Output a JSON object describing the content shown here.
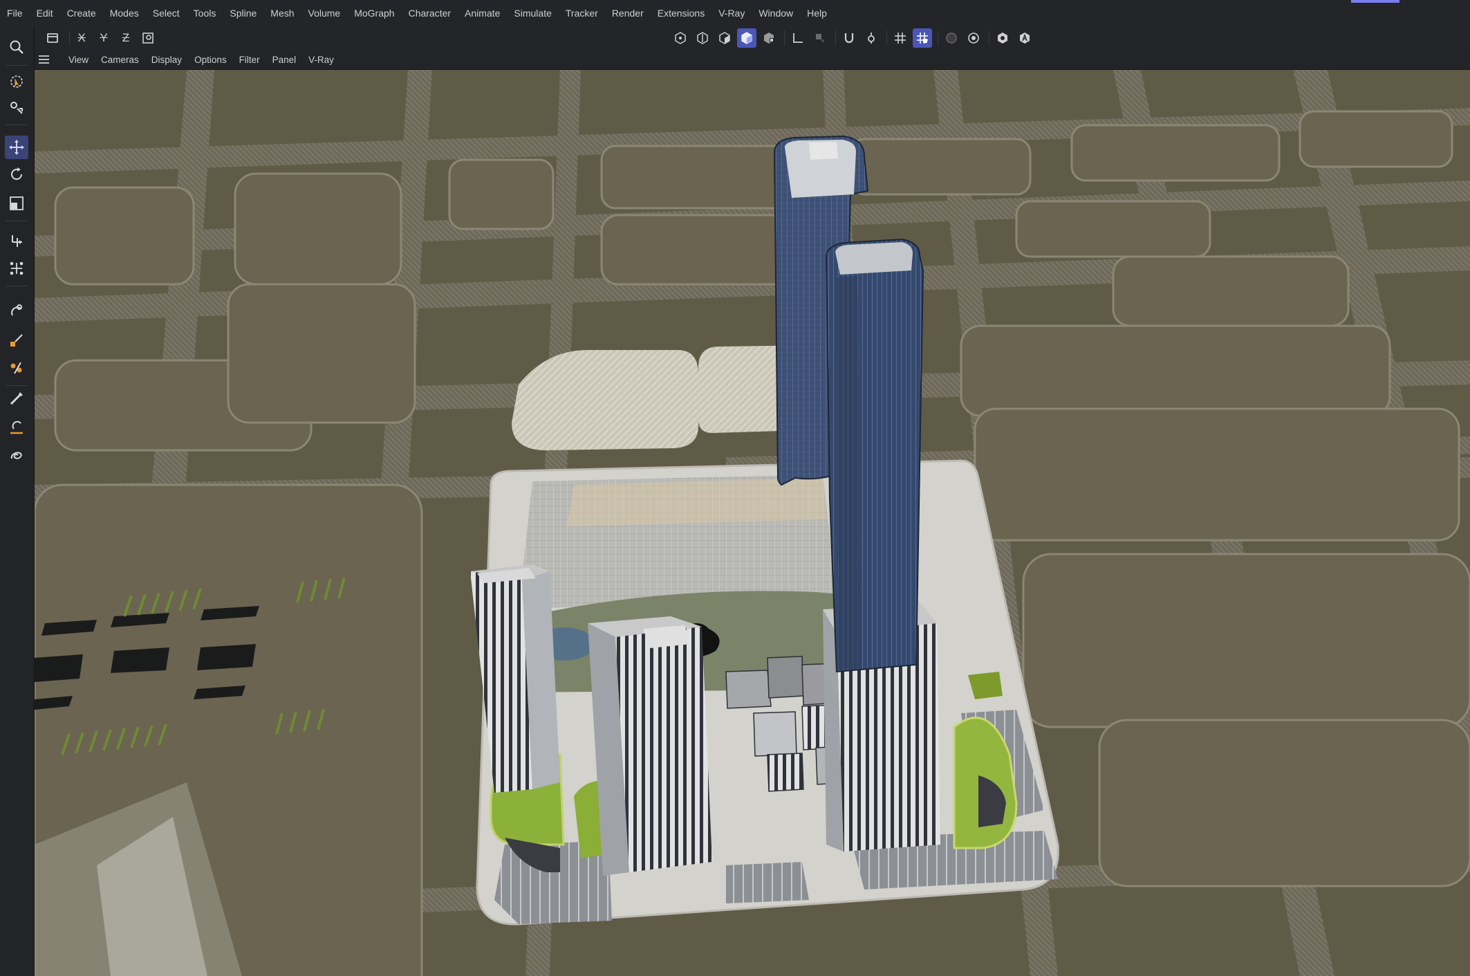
{
  "menu": [
    "File",
    "Edit",
    "Create",
    "Modes",
    "Select",
    "Tools",
    "Spline",
    "Mesh",
    "Volume",
    "MoGraph",
    "Character",
    "Animate",
    "Simulate",
    "Tracker",
    "Render",
    "Extensions",
    "V-Ray",
    "Window",
    "Help"
  ],
  "toolbar": {
    "axis_x": "X",
    "axis_y": "Y",
    "axis_z": "Z"
  },
  "viewport_menu": [
    "View",
    "Cameras",
    "Display",
    "Options",
    "Filter",
    "Panel",
    "V-Ray"
  ],
  "colors": {
    "ui_bg": "#242528",
    "accent": "#4b56b8",
    "ground": "#5f5b47",
    "road": "#7c776a",
    "glass_tower": "#3c4f70",
    "grass": "#7d9a2c"
  },
  "icons": {
    "left_tools": [
      "search-icon",
      "live-selection-icon",
      "object-mode-icon",
      "move-icon",
      "rotate-icon",
      "scale-icon",
      "transfer-icon",
      "scatter-icon",
      "magnet-icon",
      "knife-icon",
      "sculpt-icon",
      "brush-icon",
      "spline-pen-icon",
      "lasso-icon"
    ],
    "toolbar": [
      "undo-last-icon",
      "lock-x-icon",
      "lock-y-icon",
      "lock-z-icon",
      "coord-system-icon",
      "points-mode-icon",
      "edges-mode-icon",
      "polygons-mode-icon",
      "model-mode-icon",
      "uv-mode-icon",
      "axis-mode-icon",
      "texture-mode-icon",
      "snap-icon",
      "snap-settings-icon",
      "grid-icon",
      "workplane-icon",
      "render-view-icon",
      "render-settings-icon",
      "vray-settings-icon",
      "vray-render-icon"
    ]
  }
}
